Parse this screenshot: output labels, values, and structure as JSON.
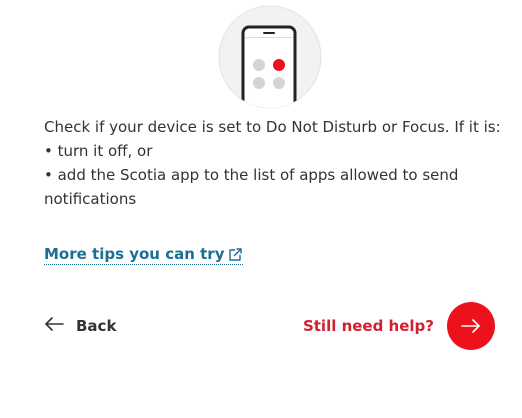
{
  "illustration": {
    "icon": "phone-do-not-disturb-icon"
  },
  "instructions": {
    "intro": "Check if your device is set to Do Not Disturb or Focus. If it is:",
    "bullets": [
      "• turn it off, or",
      "• add the Scotia app to the list of apps allowed to send notifications"
    ]
  },
  "tips_link": {
    "label": "More tips you can try",
    "icon": "external-link-icon"
  },
  "back": {
    "label": "Back",
    "icon": "arrow-left-icon"
  },
  "help": {
    "label": "Still need help?",
    "icon": "arrow-right-icon"
  },
  "colors": {
    "accent": "#ec111a",
    "link": "#1a6f93",
    "text": "#333333"
  }
}
